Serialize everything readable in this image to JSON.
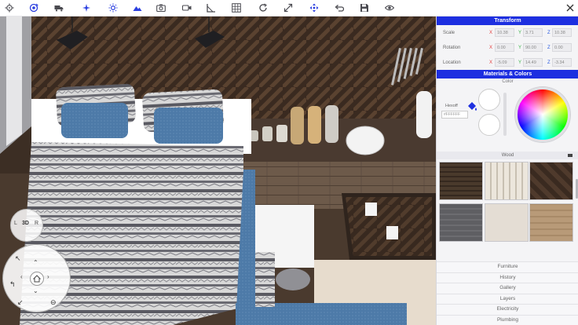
{
  "toolbar": {
    "icons": [
      "gear-icon",
      "rotate-view-icon",
      "truck-icon",
      "magic-wand-icon",
      "sun-icon",
      "terrain-icon",
      "camera-icon",
      "video-camera-icon",
      "ruler-angle-icon",
      "grid-icon",
      "refresh-icon",
      "resize-icon",
      "move-icon",
      "undo-icon",
      "save-icon",
      "eye-icon",
      "close-icon"
    ],
    "accent": "#1d2fe0"
  },
  "nav_pad": {
    "mode_label": "3D",
    "left_label": "L",
    "right_label": "R"
  },
  "transform": {
    "title": "Transform",
    "rows": [
      {
        "label": "Scale",
        "x": "10.38",
        "y": "3.71",
        "z": "10.38"
      },
      {
        "label": "Rotation",
        "x": "0.00",
        "y": "90.00",
        "z": "0.00"
      },
      {
        "label": "Location",
        "x": "-5.09",
        "y": "14.49",
        "z": "-3.34"
      }
    ],
    "axis_labels": {
      "x": "X",
      "y": "Y",
      "z": "Z"
    },
    "axis_colors": {
      "x": "#e23b3b",
      "y": "#3bb34a",
      "z": "#2b5ce0"
    }
  },
  "materials": {
    "title": "Materials & Colors",
    "color_label": "Color",
    "hex_label": "Hexoff",
    "hex_value": "#FFFFFF",
    "wood_label": "Wood",
    "swatch_colors": [
      "#4a3a2c",
      "#d8d2c6",
      "#3a2a20",
      "#5e5e62",
      "#e4ddd4",
      "#b89a78",
      "#9a7a5a",
      "#d9c7b0",
      "#6b4a36"
    ]
  },
  "nav_items": [
    "Furniture",
    "History",
    "Gallery",
    "Layers",
    "Electricity",
    "Plumbing"
  ]
}
